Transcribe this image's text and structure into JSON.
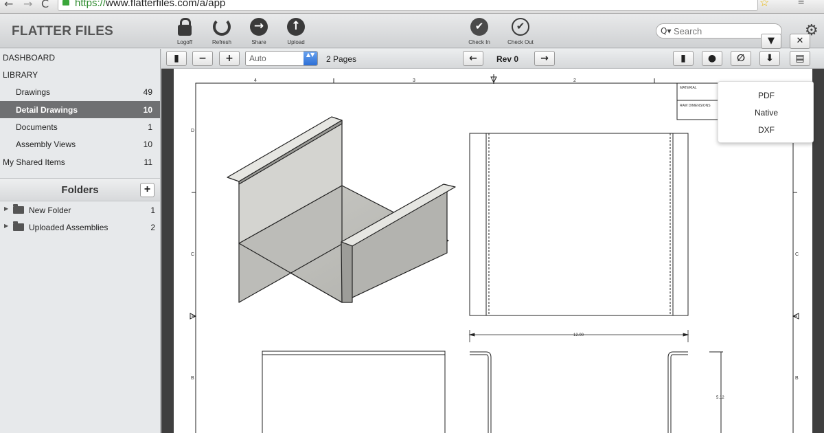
{
  "browser": {
    "url_scheme": "https://",
    "url_rest": "www.flatterfiles.com/a/app",
    "back_icon": "←",
    "forward_icon": "→",
    "reload_icon": "C",
    "star_icon": "☆",
    "menu_icon": "≡"
  },
  "header": {
    "brand": "FLATTER FILES",
    "buttons": [
      {
        "label": "Logoff",
        "icon": "lock-icon"
      },
      {
        "label": "Refresh",
        "icon": "refresh-icon"
      },
      {
        "label": "Share",
        "icon": "share-arrow-icon"
      },
      {
        "label": "Upload",
        "icon": "upload-arrow-icon"
      },
      {
        "label": "Check In",
        "icon": "check-circle-icon"
      },
      {
        "label": "Check Out",
        "icon": "check-outline-icon"
      }
    ],
    "search_placeholder": "Search",
    "search_glass": "Q▾",
    "gear_icon": "⚙"
  },
  "sidebar": {
    "items": [
      {
        "label": "DASHBOARD",
        "count": ""
      },
      {
        "label": "LIBRARY",
        "count": ""
      },
      {
        "label": "Drawings",
        "count": "49"
      },
      {
        "label": "Detail Drawings",
        "count": "10"
      },
      {
        "label": "Documents",
        "count": "1"
      },
      {
        "label": "Assembly Views",
        "count": "10"
      },
      {
        "label": "My Shared Items",
        "count": "11"
      }
    ],
    "folders_title": "Folders",
    "add_label": "+",
    "folders": [
      {
        "label": "New Folder",
        "count": "1"
      },
      {
        "label": "Uploaded Assemblies",
        "count": "2"
      }
    ]
  },
  "viewer": {
    "panel_icon": "▮",
    "zoom_out": "−",
    "zoom_in": "+",
    "zoom_value": "Auto",
    "zoom_arrows": "▲▼",
    "pages": "2 Pages",
    "prev_icon": "←",
    "rev": "Rev 0",
    "next_icon": "→",
    "right_icons": [
      "▮",
      "●",
      "∅",
      "⬇",
      "▤"
    ]
  },
  "drawing": {
    "zone_cols": [
      "4",
      "3",
      "2"
    ],
    "zone_rows": [
      "D",
      "C",
      "B"
    ],
    "title_block": [
      "MATERIAL",
      "RAW DIMENSIONS"
    ],
    "dims": [
      "12.00",
      "5.12"
    ]
  },
  "download_menu": {
    "items": [
      "PDF",
      "Native",
      "DXF"
    ],
    "toggle_icon": "▼",
    "close_icon": "✕"
  }
}
